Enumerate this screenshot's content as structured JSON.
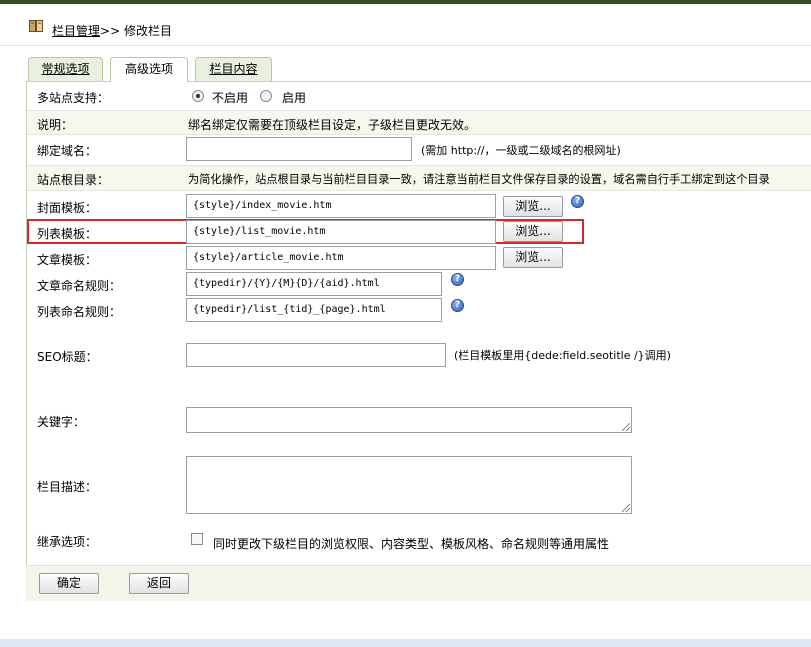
{
  "header": {
    "crumb_link": "栏目管理",
    "crumb_separator": ">>",
    "crumb_current": "修改栏目"
  },
  "tabs": [
    {
      "label": "常规选项"
    },
    {
      "label": "高级选项"
    },
    {
      "label": "栏目内容"
    }
  ],
  "form": {
    "multisite": {
      "label": "多站点支持：",
      "opt_off": "不启用",
      "opt_on": "启用",
      "selected": "不启用"
    },
    "note": {
      "label": "说明：",
      "text": "绑名绑定仅需要在顶级栏目设定，子级栏目更改无效。"
    },
    "bind_domain": {
      "label": "绑定域名：",
      "value": "",
      "hint": "(需加 http://，一级或二级域名的根网址)"
    },
    "site_root": {
      "label": "站点根目录：",
      "text": "为简化操作，站点根目录与当前栏目目录一致，请注意当前栏目文件保存目录的设置，域名需自行手工绑定到这个目录"
    },
    "cover_tpl": {
      "label": "封面模板：",
      "value": "{style}/index_movie.htm"
    },
    "list_tpl": {
      "label": "列表模板：",
      "value": "{style}/list_movie.htm"
    },
    "article_tpl": {
      "label": "文章模板：",
      "value": "{style}/article_movie.htm"
    },
    "article_rule": {
      "label": "文章命名规则：",
      "value": "{typedir}/{Y}/{M}{D}/{aid}.html"
    },
    "list_rule": {
      "label": "列表命名规则：",
      "value": "{typedir}/list_{tid}_{page}.html"
    },
    "seo_title": {
      "label": "SEO标题：",
      "value": "",
      "hint": "(栏目模板里用{dede:field.seotitle /}调用)"
    },
    "keywords": {
      "label": "关键字：",
      "value": ""
    },
    "description": {
      "label": "栏目描述：",
      "value": ""
    },
    "inherit": {
      "label": "继承选项：",
      "text": "同时更改下级栏目的浏览权限、内容类型、模板风格、命名规则等通用属性"
    },
    "browse_label": "浏览...",
    "help_glyph": "?"
  },
  "buttons": {
    "confirm": "确定",
    "back": "返回"
  },
  "colors": {
    "highlight": "#d42a2a",
    "tab_bg": "#e9f0dd",
    "row_shade": "#f5f8ee"
  }
}
